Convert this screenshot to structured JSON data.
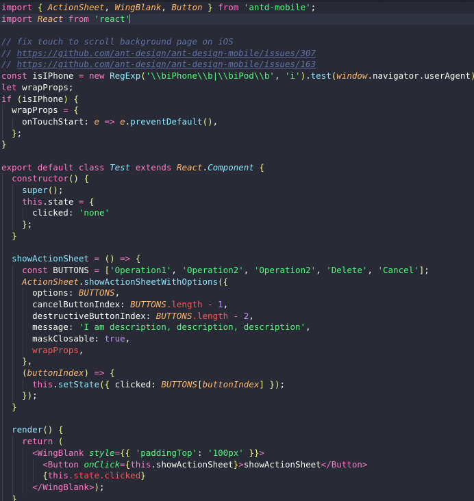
{
  "editor": {
    "theme_name": "dracula",
    "background": "#282a36",
    "foreground": "#f8f8f2",
    "current_line_background": "#2f3240",
    "indent_guide_color": "#3b3e4d",
    "font_size_px": 12.5,
    "line_height_px": 16.7,
    "language": "javascript-jsx",
    "cursor_line": 2
  },
  "palette": {
    "keyword": "#ff79c6",
    "string": "#50fa7b",
    "number": "#bd93f9",
    "comment": "#6272a4",
    "function": "#8be9fd",
    "punctuation": "#f1fa8c",
    "parameter": "#ffb86c",
    "member": "#ff5555",
    "tag": "#ff79c6",
    "attribute": "#50fa7b"
  },
  "tabstrip": {
    "divider_positions": [
      76,
      247,
      418,
      553,
      675
    ]
  },
  "code": {
    "lines": [
      "import { ActionSheet, WingBlank, Button } from 'antd-mobile';",
      "import React from 'react'",
      "",
      "// fix touch to scroll background page on iOS",
      "// https://github.com/ant-design/ant-design-mobile/issues/307",
      "// https://github.com/ant-design/ant-design-mobile/issues/163",
      "const isIPhone = new RegExp('\\\\biPhone\\\\b|\\\\biPod\\\\b', 'i').test(window.navigator.userAgent);",
      "let wrapProps;",
      "if (isIPhone) {",
      "  wrapProps = {",
      "    onTouchStart: e => e.preventDefault(),",
      "  };",
      "}",
      "",
      "export default class Test extends React.Component {",
      "  constructor() {",
      "    super();",
      "    this.state = {",
      "      clicked: 'none'",
      "    };",
      "  }",
      "",
      "  showActionSheet = () => {",
      "    const BUTTONS = ['Operation1', 'Operation2', 'Operation2', 'Delete', 'Cancel'];",
      "    ActionSheet.showActionSheetWithOptions({",
      "      options: BUTTONS,",
      "      cancelButtonIndex: BUTTONS.length - 1,",
      "      destructiveButtonIndex: BUTTONS.length - 2,",
      "      message: 'I am description, description, description',",
      "      maskClosable: true,",
      "      wrapProps,",
      "    },",
      "    (buttonIndex) => {",
      "      this.setState({ clicked: BUTTONS[buttonIndex] });",
      "    });",
      "  }",
      "",
      "  render() {",
      "    return (",
      "      <WingBlank style={{ 'paddingTop': '100px' }}>",
      "        <Button onClick={this.showActionSheet}>showActionSheet</Button>",
      "        {this.state.clicked}",
      "      </WingBlank>);",
      "  }"
    ],
    "comment_urls": [
      "https://github.com/ant-design/ant-design-mobile/issues/307",
      "https://github.com/ant-design/ant-design-mobile/issues/163"
    ],
    "imported_bindings": [
      "ActionSheet",
      "WingBlank",
      "Button"
    ],
    "import_sources": [
      "antd-mobile",
      "react"
    ],
    "button_labels": [
      "Operation1",
      "Operation2",
      "Operation2",
      "Delete",
      "Cancel"
    ],
    "action_sheet_message": "I am description, description, description",
    "initial_state_clicked": "none",
    "class_name": "Test",
    "padding_top_value": "100px",
    "button_text": "showActionSheet"
  }
}
